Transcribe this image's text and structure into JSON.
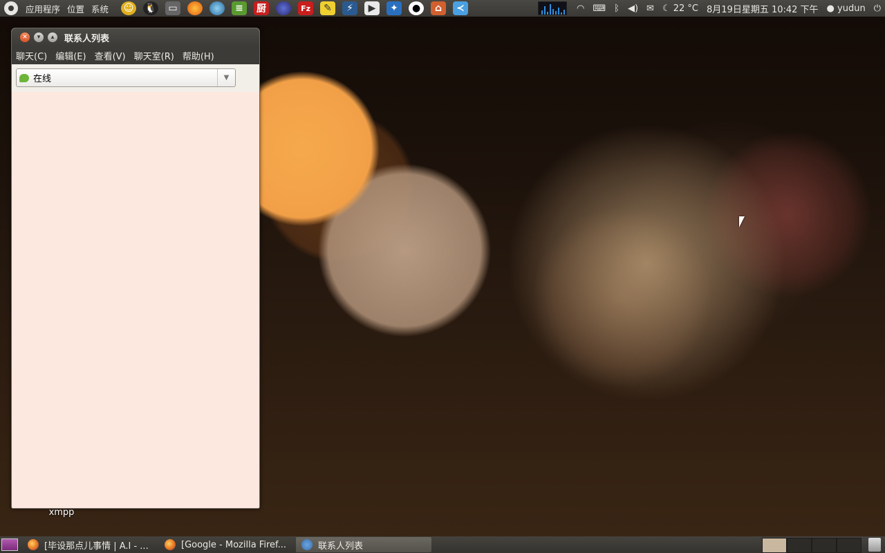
{
  "topbar": {
    "menus": [
      "应用程序",
      "位置",
      "系统"
    ],
    "launcher_icons": [
      "qq-pet-icon",
      "qq-icon",
      "terminal-icon",
      "firefox-icon",
      "browser-globe-icon",
      "book-icon",
      "chef-icon",
      "eclipse-icon",
      "filezilla-icon",
      "notes-icon",
      "flash-icon",
      "video-icon",
      "bird-icon",
      "panda-icon",
      "folder-icon",
      "swift-icon"
    ],
    "launcher_labels": {
      "chef": "厨",
      "filezilla": "Fz"
    },
    "temperature": "22 °C",
    "datetime": "8月19日星期五 10:42 下午",
    "user": "yudun"
  },
  "window": {
    "title": "联系人列表",
    "menubar": [
      "聊天(C)",
      "编辑(E)",
      "查看(V)",
      "聊天室(R)",
      "帮助(H)"
    ],
    "status_value": "在线"
  },
  "desktop": {
    "icon_label": "xmpp"
  },
  "taskbar": {
    "tasks": [
      {
        "label": "[毕设那点儿事情 | A.I - ...",
        "icon": "firefox-icon",
        "active": false
      },
      {
        "label": "[Google - Mozilla Firef...",
        "icon": "firefox-icon",
        "active": false
      },
      {
        "label": "联系人列表",
        "icon": "pidgin-icon",
        "active": true
      }
    ],
    "workspaces": 4,
    "current_workspace": 1
  }
}
